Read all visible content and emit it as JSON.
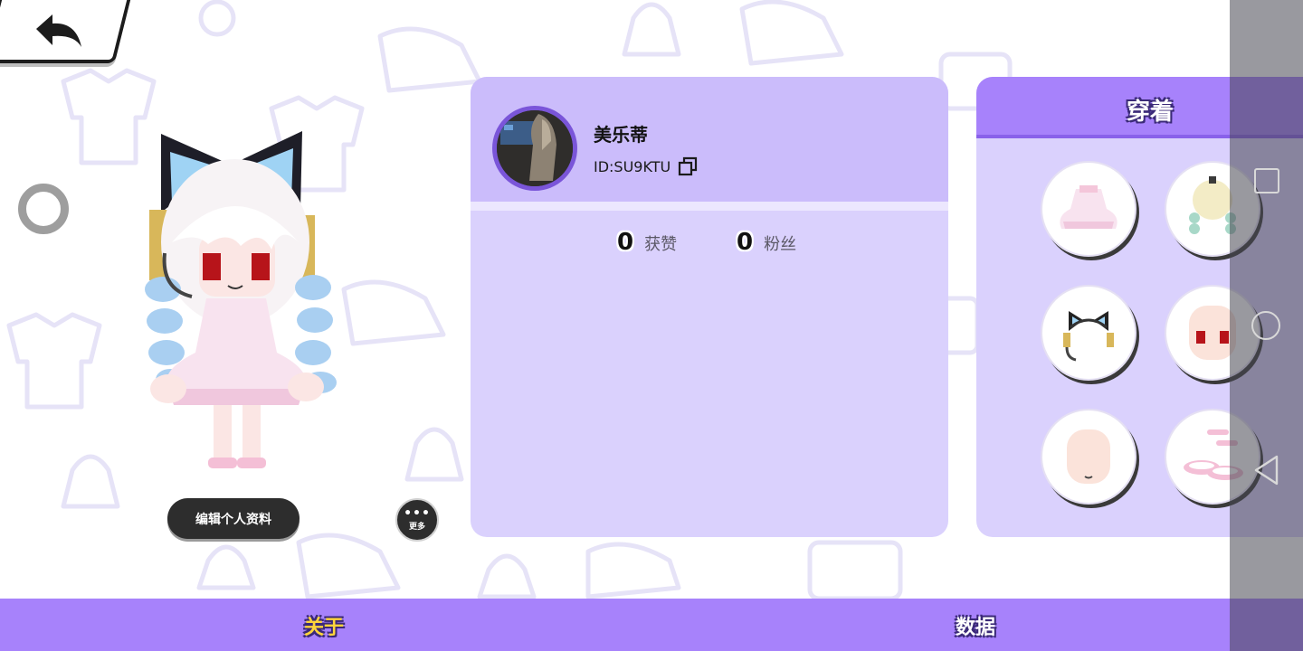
{
  "profile": {
    "nickname": "美乐蒂",
    "id_text": "ID:SU9KTU",
    "stats": [
      {
        "value": "0",
        "label": "获赞"
      },
      {
        "value": "0",
        "label": "粉丝"
      }
    ]
  },
  "actions": {
    "edit_profile_label": "编辑个人资料",
    "more_label": "更多"
  },
  "outfit": {
    "title": "穿着",
    "items": [
      {
        "icon": "dress-icon"
      },
      {
        "icon": "hair-icon"
      },
      {
        "icon": "cat-ear-headset-icon"
      },
      {
        "icon": "face-icon"
      },
      {
        "icon": "head-icon"
      },
      {
        "icon": "shoes-icon"
      }
    ]
  },
  "tabs": [
    {
      "label": "关于",
      "active": true
    },
    {
      "label": "数据",
      "active": false
    }
  ],
  "colors": {
    "accent": "#a782fb",
    "card": "#dad1fd",
    "card_header": "#cbbcfb",
    "active_tab_text": "#ffd53b"
  }
}
